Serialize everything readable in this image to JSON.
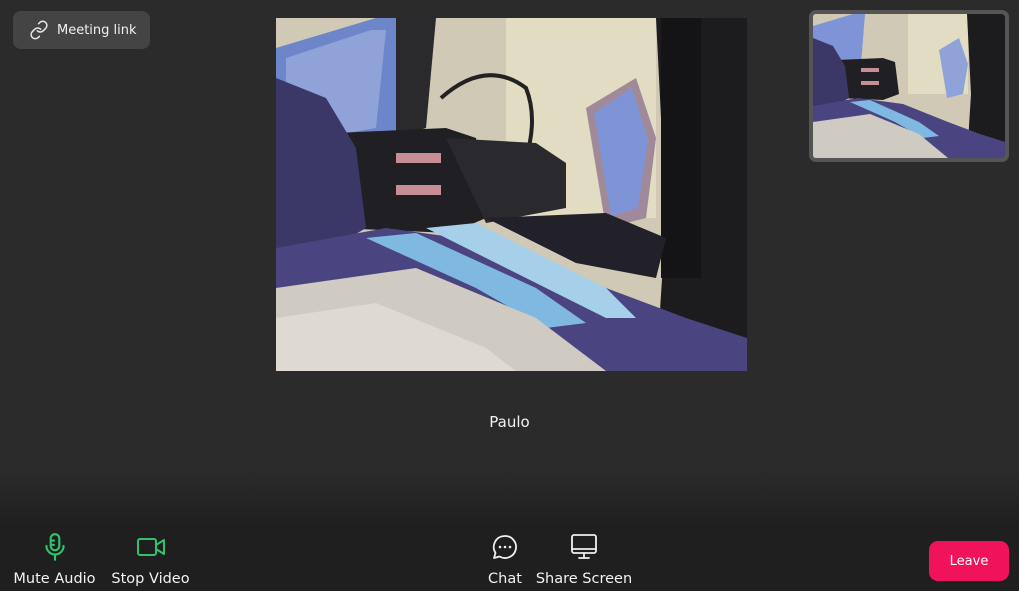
{
  "top_bar": {
    "meeting_link_label": "Meeting link",
    "meeting_link_icon": "link-icon"
  },
  "main_video": {
    "participant_name": "Paulo"
  },
  "toolbar": {
    "mute_audio_label": "Mute Audio",
    "stop_video_label": "Stop Video",
    "chat_label": "Chat",
    "share_screen_label": "Share Screen",
    "leave_label": "Leave",
    "icons": {
      "mute_audio": "microphone-icon",
      "stop_video": "video-camera-icon",
      "chat": "chat-bubble-icon",
      "share_screen": "monitor-icon"
    }
  },
  "colors": {
    "background": "#2b2b2b",
    "toolbar_background": "#1f1f1f",
    "active_green": "#2fc46b",
    "leave_red": "#f0125a",
    "meeting_link_background": "#444444"
  }
}
